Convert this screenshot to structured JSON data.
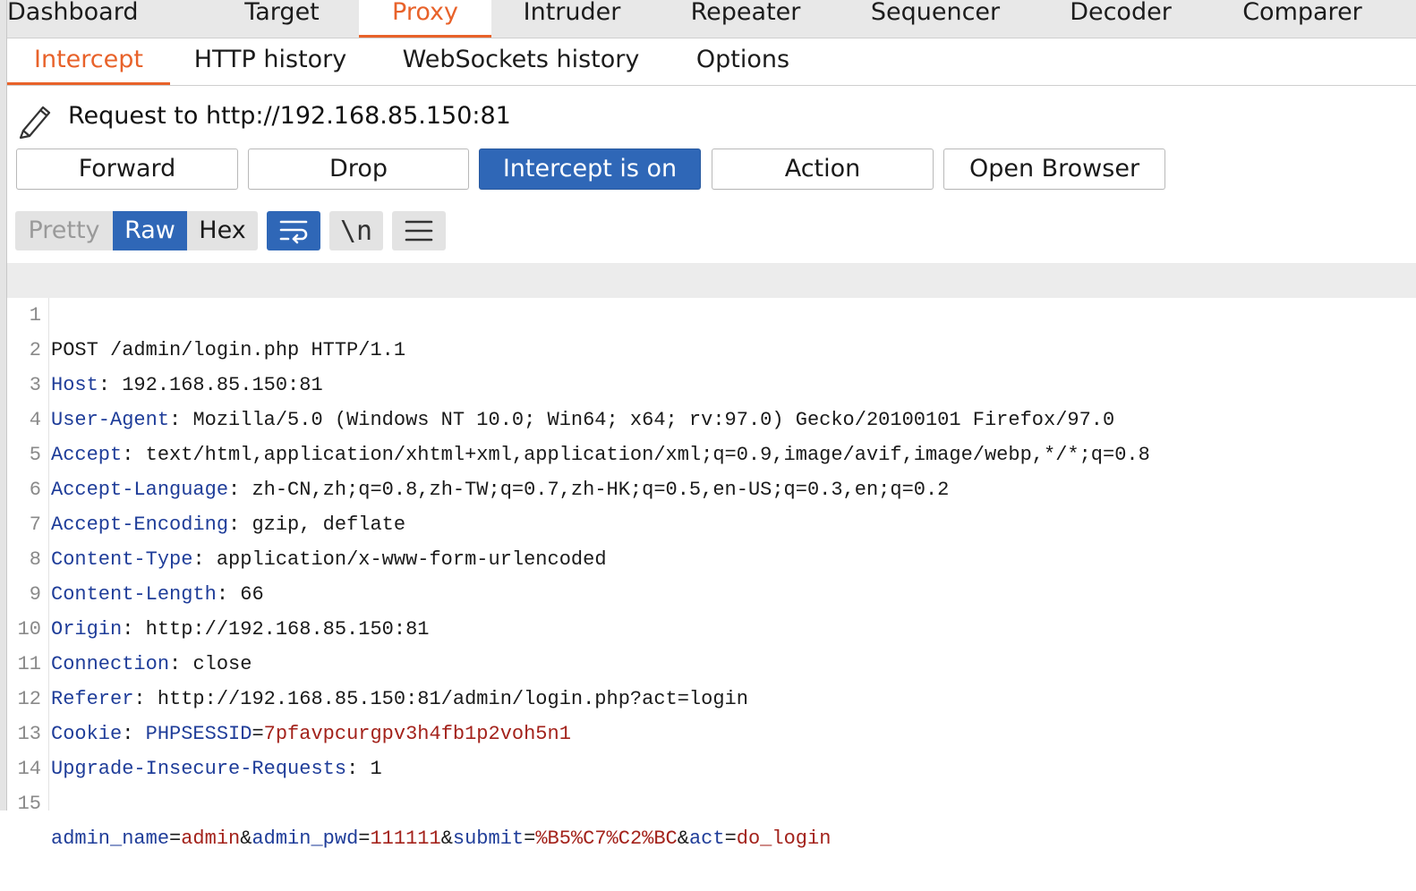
{
  "top_tabs": [
    "Dashboard",
    "Target",
    "Proxy",
    "Intruder",
    "Repeater",
    "Sequencer",
    "Decoder",
    "Comparer"
  ],
  "active_top_tab": "Proxy",
  "sub_tabs": [
    "Intercept",
    "HTTP history",
    "WebSockets history",
    "Options"
  ],
  "active_sub_tab": "Intercept",
  "request_title": "Request to http://192.168.85.150:81",
  "buttons": {
    "forward": "Forward",
    "drop": "Drop",
    "intercept": "Intercept is on",
    "action": "Action",
    "open_browser": "Open Browser"
  },
  "view_modes": [
    "Pretty",
    "Raw",
    "Hex"
  ],
  "active_view_mode": "Raw",
  "toolbar_icons": [
    "wrap-lines-icon",
    "newline-icon",
    "menu-icon"
  ],
  "newline_glyph": "\\n",
  "colors": {
    "accent_orange": "#e8622a",
    "button_blue": "#2f67b7",
    "header_key": "#1f3d99",
    "param_value": "#a3221b"
  },
  "request_lines": [
    {
      "num": "1",
      "text": "POST /admin/login.php HTTP/1.1"
    },
    {
      "num": "2",
      "key": "Host",
      "value": "192.168.85.150:81"
    },
    {
      "num": "3",
      "key": "User-Agent",
      "value": "Mozilla/5.0 (Windows NT 10.0; Win64; x64; rv:97.0) Gecko/20100101 Firefox/97.0"
    },
    {
      "num": "4",
      "key": "Accept",
      "value": "text/html,application/xhtml+xml,application/xml;q=0.9,image/avif,image/webp,*/*;q=0.8"
    },
    {
      "num": "5",
      "key": "Accept-Language",
      "value": "zh-CN,zh;q=0.8,zh-TW;q=0.7,zh-HK;q=0.5,en-US;q=0.3,en;q=0.2"
    },
    {
      "num": "6",
      "key": "Accept-Encoding",
      "value": "gzip, deflate"
    },
    {
      "num": "7",
      "key": "Content-Type",
      "value": "application/x-www-form-urlencoded"
    },
    {
      "num": "8",
      "key": "Content-Length",
      "value": "66"
    },
    {
      "num": "9",
      "key": "Origin",
      "value": "http://192.168.85.150:81"
    },
    {
      "num": "10",
      "key": "Connection",
      "value": "close"
    },
    {
      "num": "11",
      "key": "Referer",
      "value": "http://192.168.85.150:81/admin/login.php?act=login"
    },
    {
      "num": "12",
      "key": "Cookie",
      "cookie_name": "PHPSESSID",
      "cookie_value": "7pfavpcurgpv3h4fb1p2voh5n1"
    },
    {
      "num": "13",
      "key": "Upgrade-Insecure-Requests",
      "value": "1"
    },
    {
      "num": "14",
      "text": ""
    },
    {
      "num": "15",
      "params": [
        {
          "name": "admin_name",
          "value": "admin"
        },
        {
          "name": "admin_pwd",
          "value": "111111"
        },
        {
          "name": "submit",
          "value": "%B5%C7%C2%BC"
        },
        {
          "name": "act",
          "value": "do_login"
        }
      ]
    }
  ]
}
